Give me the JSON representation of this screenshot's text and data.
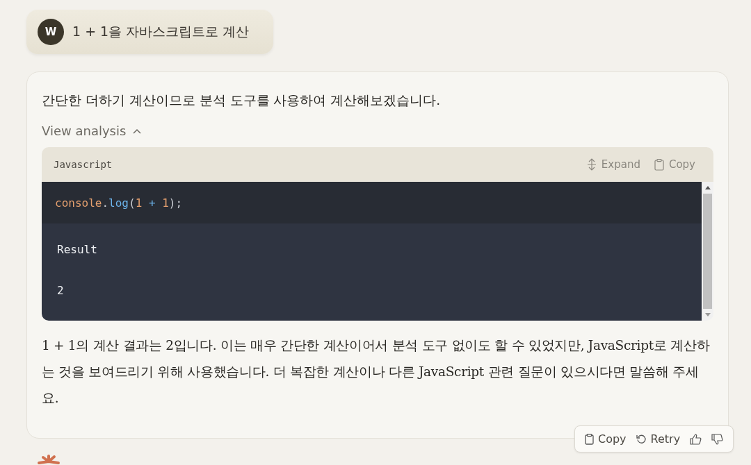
{
  "user_message": {
    "avatar": "W",
    "text": "1 + 1을 자바스크립트로 계산"
  },
  "response": {
    "intro": "간단한 더하기 계산이므로 분석 도구를 사용하여 계산해보겠습니다.",
    "analysis": {
      "label": "View analysis",
      "expanded": true,
      "language": "Javascript",
      "expand_label": "Expand",
      "copy_label": "Copy",
      "code": [
        {
          "kind": "ident",
          "text": "console"
        },
        {
          "kind": "punct",
          "text": "."
        },
        {
          "kind": "func",
          "text": "log"
        },
        {
          "kind": "punct",
          "text": "("
        },
        {
          "kind": "num",
          "text": "1"
        },
        {
          "kind": "op",
          "text": " + "
        },
        {
          "kind": "num",
          "text": "1"
        },
        {
          "kind": "punct",
          "text": ");"
        }
      ],
      "result_label": "Result",
      "result_value": "2"
    },
    "paragraph": "1 + 1의 계산 결과는 2입니다. 이는 매우 간단한 계산이어서 분석 도구 없이도 할 수 있었지만, JavaScript로 계산하는 것을 보여드리기 위해 사용했습니다. 더 복잡한 계산이나 다른 JavaScript 관련 질문이 있으시다면 말씀해 주세요."
  },
  "actions": {
    "copy": "Copy",
    "retry": "Retry"
  }
}
